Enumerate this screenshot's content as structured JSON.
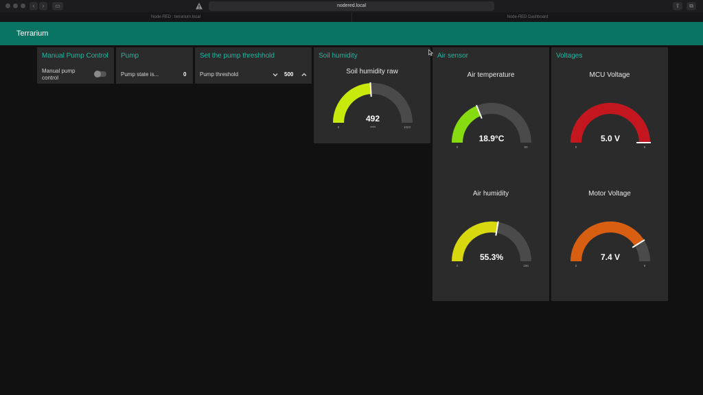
{
  "browser": {
    "url": "nodered.local",
    "tabs": [
      "Node-RED : terrarium.local",
      "Node-RED Dashboard"
    ]
  },
  "header": {
    "title": "Terrarium"
  },
  "groups": {
    "manual": {
      "title": "Manual Pump Control",
      "label_line1": "Manual pump",
      "label_line2": "control",
      "switch_on": false
    },
    "pump": {
      "title": "Pump",
      "label": "Pump state is...",
      "value": "0"
    },
    "threshold": {
      "title": "Set the pump threshhold",
      "label": "Pump threshold",
      "value": "500",
      "down_icon": "chevron-down-icon",
      "up_icon": "chevron-up-icon"
    },
    "soil": {
      "title": "Soil humidity"
    },
    "air": {
      "title": "Air sensor"
    },
    "volt": {
      "title": "Voltages"
    }
  },
  "gauges": [
    {
      "id": "soil",
      "title": "Soil humidity raw",
      "value": 492,
      "display": "492",
      "unit": "units",
      "min": 0,
      "max": 1023,
      "min_label": "0",
      "max_label": "1023",
      "color": "#c9e80c"
    },
    {
      "id": "airtemp",
      "title": "Air temperature",
      "value": 18.9,
      "display": "18.9°C",
      "unit": "",
      "min": 0,
      "max": 50,
      "min_label": "0",
      "max_label": "50",
      "color": "#86dc10"
    },
    {
      "id": "mcu",
      "title": "MCU Voltage",
      "value": 5.0,
      "display": "5.0 V",
      "unit": "",
      "min": 0,
      "max": 5,
      "min_label": "0",
      "max_label": "5",
      "color": "#c4161f"
    },
    {
      "id": "airhum",
      "title": "Air humidity",
      "value": 55.3,
      "display": "55.3%",
      "unit": "",
      "min": 0,
      "max": 100,
      "min_label": "0",
      "max_label": "100",
      "color": "#d8d80e"
    },
    {
      "id": "motor",
      "title": "Motor Voltage",
      "value": 7.4,
      "display": "7.4 V",
      "unit": "",
      "min": 0,
      "max": 9,
      "min_label": "0",
      "max_label": "9",
      "color": "#d85e12"
    }
  ],
  "colors": {
    "accent": "#20b8a4",
    "header": "#0a7464",
    "track": "#4a4a4a"
  }
}
